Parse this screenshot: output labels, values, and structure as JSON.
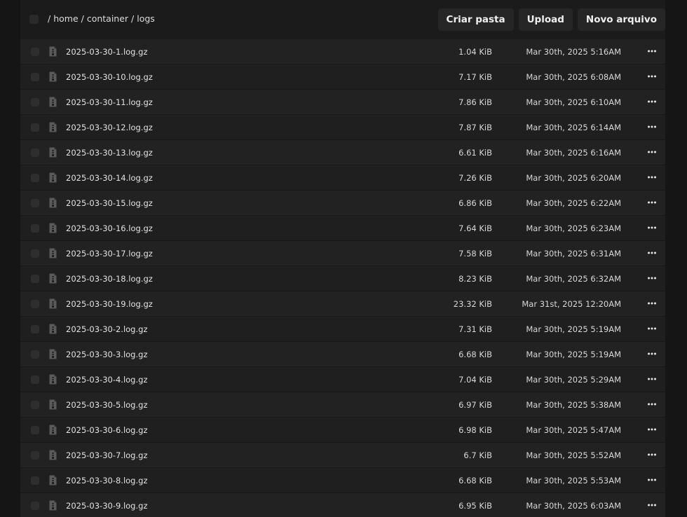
{
  "breadcrumb": {
    "sep1": "/",
    "seg1": "home",
    "sep2": "/",
    "seg2": "container",
    "sep3": "/",
    "seg3": "logs"
  },
  "toolbar": {
    "create_folder": "Criar pasta",
    "upload": "Upload",
    "new_file": "Novo arquivo"
  },
  "files": [
    {
      "name": "2025-03-30-1.log.gz",
      "size": "1.04 KiB",
      "date": "Mar 30th, 2025 5:16AM"
    },
    {
      "name": "2025-03-30-10.log.gz",
      "size": "7.17 KiB",
      "date": "Mar 30th, 2025 6:08AM"
    },
    {
      "name": "2025-03-30-11.log.gz",
      "size": "7.86 KiB",
      "date": "Mar 30th, 2025 6:10AM"
    },
    {
      "name": "2025-03-30-12.log.gz",
      "size": "7.87 KiB",
      "date": "Mar 30th, 2025 6:14AM"
    },
    {
      "name": "2025-03-30-13.log.gz",
      "size": "6.61 KiB",
      "date": "Mar 30th, 2025 6:16AM"
    },
    {
      "name": "2025-03-30-14.log.gz",
      "size": "7.26 KiB",
      "date": "Mar 30th, 2025 6:20AM"
    },
    {
      "name": "2025-03-30-15.log.gz",
      "size": "6.86 KiB",
      "date": "Mar 30th, 2025 6:22AM"
    },
    {
      "name": "2025-03-30-16.log.gz",
      "size": "7.64 KiB",
      "date": "Mar 30th, 2025 6:23AM"
    },
    {
      "name": "2025-03-30-17.log.gz",
      "size": "7.58 KiB",
      "date": "Mar 30th, 2025 6:31AM"
    },
    {
      "name": "2025-03-30-18.log.gz",
      "size": "8.23 KiB",
      "date": "Mar 30th, 2025 6:32AM"
    },
    {
      "name": "2025-03-30-19.log.gz",
      "size": "23.32 KiB",
      "date": "Mar 31st, 2025 12:20AM"
    },
    {
      "name": "2025-03-30-2.log.gz",
      "size": "7.31 KiB",
      "date": "Mar 30th, 2025 5:19AM"
    },
    {
      "name": "2025-03-30-3.log.gz",
      "size": "6.68 KiB",
      "date": "Mar 30th, 2025 5:19AM"
    },
    {
      "name": "2025-03-30-4.log.gz",
      "size": "7.04 KiB",
      "date": "Mar 30th, 2025 5:29AM"
    },
    {
      "name": "2025-03-30-5.log.gz",
      "size": "6.97 KiB",
      "date": "Mar 30th, 2025 5:38AM"
    },
    {
      "name": "2025-03-30-6.log.gz",
      "size": "6.98 KiB",
      "date": "Mar 30th, 2025 5:47AM"
    },
    {
      "name": "2025-03-30-7.log.gz",
      "size": "6.7 KiB",
      "date": "Mar 30th, 2025 5:52AM"
    },
    {
      "name": "2025-03-30-8.log.gz",
      "size": "6.68 KiB",
      "date": "Mar 30th, 2025 5:53AM"
    },
    {
      "name": "2025-03-30-9.log.gz",
      "size": "6.95 KiB",
      "date": "Mar 30th, 2025 6:03AM"
    }
  ],
  "icons": {
    "file": "file-archive-icon",
    "more": "ellipsis-icon"
  },
  "colors": {
    "background": "#151515",
    "row": "#222222",
    "button": "#262626"
  }
}
